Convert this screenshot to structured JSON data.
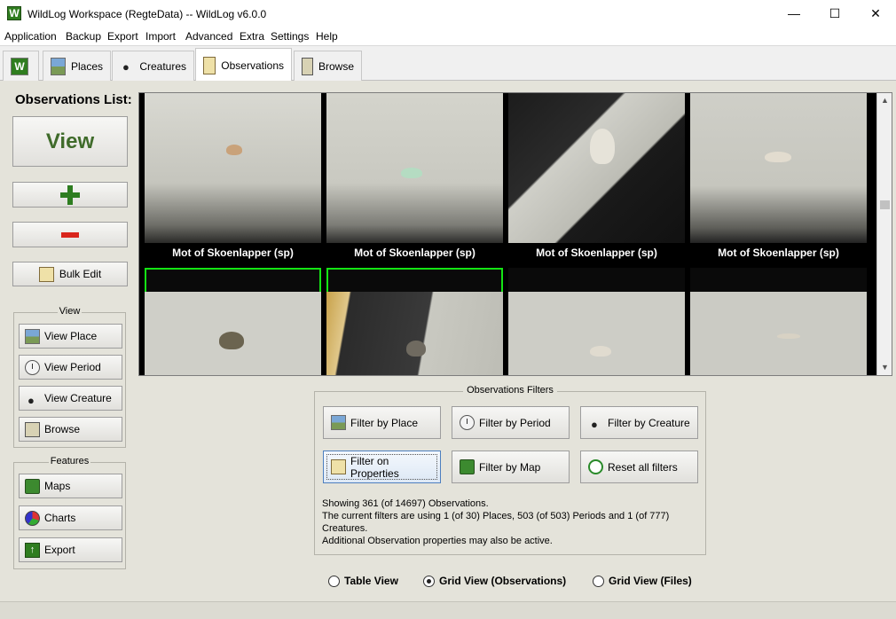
{
  "window": {
    "title": "WildLog Workspace (RegteData) -- WildLog v6.0.0",
    "app_icon_letter": "W",
    "controls": [
      "—",
      "☐",
      "✕"
    ]
  },
  "menu": [
    "Application",
    "Backup",
    "Export",
    "Import",
    "Advanced",
    "Extra",
    "Settings",
    "Help"
  ],
  "tabs": [
    {
      "label": "",
      "icon": "wildlog-logo-icon"
    },
    {
      "label": "Places",
      "icon": "landscape-icon"
    },
    {
      "label": "Creatures",
      "icon": "paw-icon"
    },
    {
      "label": "Observations",
      "icon": "notes-icon",
      "active": true
    },
    {
      "label": "Browse",
      "icon": "book-icon"
    }
  ],
  "sidebar": {
    "title": "Observations List:",
    "view_label": "View",
    "add_label": "+",
    "delete_label": "−",
    "bulk_edit_label": "Bulk Edit",
    "view_group": {
      "legend": "View",
      "items": [
        {
          "label": "View  Place",
          "icon": "landscape-icon"
        },
        {
          "label": "View Period",
          "icon": "clock-icon"
        },
        {
          "label": "View Creature",
          "icon": "paw-icon"
        },
        {
          "label": "Browse",
          "icon": "book-icon"
        }
      ]
    },
    "features_group": {
      "legend": "Features",
      "items": [
        {
          "label": "Maps",
          "icon": "map-icon"
        },
        {
          "label": "Charts",
          "icon": "pie-chart-icon"
        },
        {
          "label": "Export",
          "icon": "export-arrow-icon"
        }
      ]
    }
  },
  "grid": {
    "tiles": [
      {
        "caption": "Mot of Skoenlapper (sp)",
        "selected": false
      },
      {
        "caption": "Mot of Skoenlapper (sp)",
        "selected": true
      },
      {
        "caption": "Mot of Skoenlapper (sp)",
        "selected": false
      },
      {
        "caption": "Mot of Skoenlapper (sp)",
        "selected": false
      },
      {
        "caption": "",
        "selected": true
      },
      {
        "caption": "",
        "selected": true
      },
      {
        "caption": "",
        "selected": false
      },
      {
        "caption": "",
        "selected": false
      }
    ]
  },
  "filters": {
    "legend": "Observations Filters",
    "buttons": [
      {
        "label": "Filter by Place",
        "icon": "landscape-icon"
      },
      {
        "label": "Filter by Period",
        "icon": "clock-icon"
      },
      {
        "label": "Filter by Creature",
        "icon": "paw-icon"
      },
      {
        "label": "Filter on Properties",
        "icon": "notes-icon"
      },
      {
        "label": "Filter by Map",
        "icon": "map-icon"
      },
      {
        "label": "Reset all filters",
        "icon": "refresh-icon"
      }
    ],
    "summary": [
      "Showing 361 (of 14697) Observations.",
      "The current filters are using 1 (of 30) Places, 503 (of 503) Periods and 1 (of 777)",
      "Creatures.",
      "Additional Observation properties may also be active."
    ]
  },
  "view_modes": [
    {
      "label": "Table View",
      "selected": false
    },
    {
      "label": "Grid View (Observations)",
      "selected": true
    },
    {
      "label": "Grid View (Files)",
      "selected": false
    }
  ]
}
